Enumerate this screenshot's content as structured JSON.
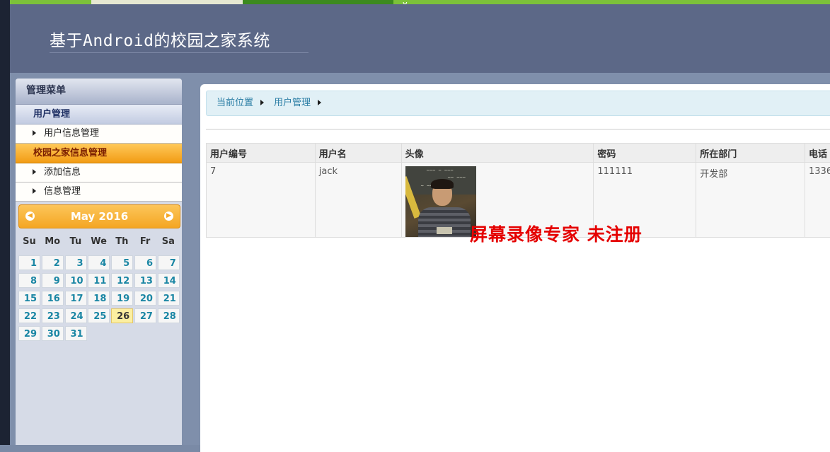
{
  "header": {
    "title": "基于Android的校园之家系统"
  },
  "sidebar": {
    "title": "管理菜单",
    "groups": [
      {
        "label": "用户管理",
        "items": [
          {
            "label": "用户信息管理"
          }
        ]
      },
      {
        "label": "校园之家信息管理",
        "items": [
          {
            "label": "添加信息"
          },
          {
            "label": "信息管理"
          }
        ]
      }
    ]
  },
  "calendar": {
    "month_label": "May 2016",
    "weekdays": [
      "Su",
      "Mo",
      "Tu",
      "We",
      "Th",
      "Fr",
      "Sa"
    ],
    "days": [
      "1",
      "2",
      "3",
      "4",
      "5",
      "6",
      "7",
      "8",
      "9",
      "10",
      "11",
      "12",
      "13",
      "14",
      "15",
      "16",
      "17",
      "18",
      "19",
      "20",
      "21",
      "22",
      "23",
      "24",
      "25",
      "26",
      "27",
      "28",
      "29",
      "30",
      "31"
    ],
    "today": "26"
  },
  "breadcrumb": {
    "items": [
      "当前位置",
      "用户管理"
    ]
  },
  "table": {
    "headers": [
      "用户编号",
      "用户名",
      "头像",
      "密码",
      "所在部门",
      "电话"
    ],
    "rows": [
      {
        "id": "7",
        "username": "jack",
        "password": "111111",
        "department": "开发部",
        "phone": "1336"
      }
    ]
  },
  "watermark": "屏幕录像专家  未注册",
  "colors": {
    "header_bg": "#5c6887",
    "accent_orange": "#f4a623",
    "link_blue": "#2d7fa6",
    "watermark_red": "#e50000"
  }
}
